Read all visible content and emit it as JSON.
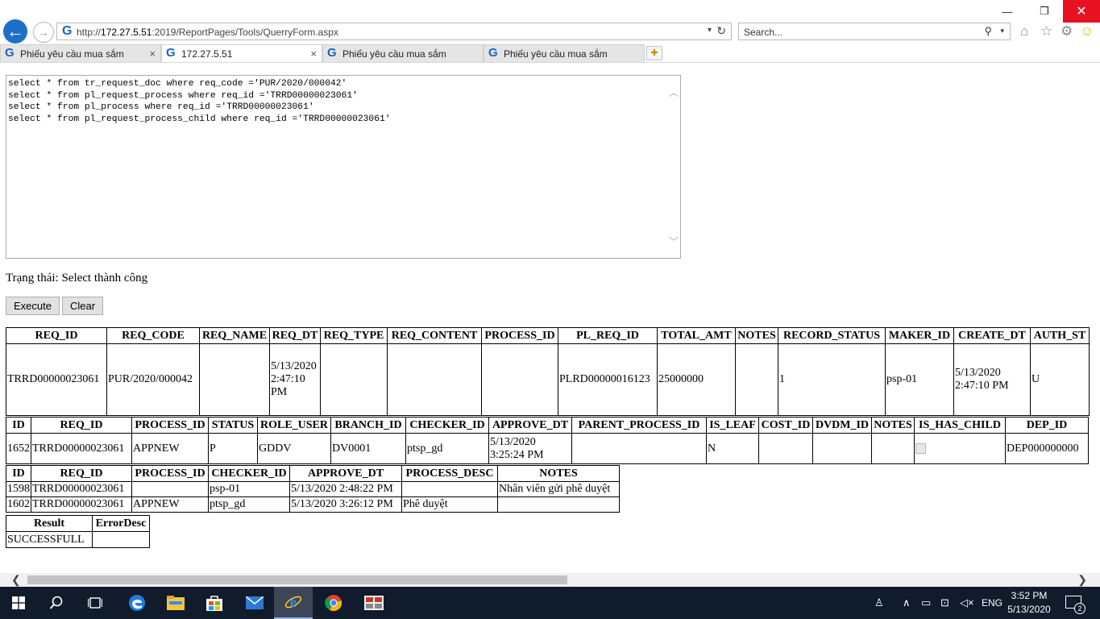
{
  "browser": {
    "address": {
      "prefix": "http://",
      "host": "172.27.5.51",
      "path": ":2019/ReportPages/Tools/QuerryForm.aspx"
    },
    "search_placeholder": "Search...",
    "tabs": [
      {
        "label": "Phiếu yêu cầu mua sắm",
        "active": false,
        "close": "×"
      },
      {
        "label": "172.27.5.51",
        "active": true,
        "close": "×"
      },
      {
        "label": "Phiếu yêu cầu mua sắm",
        "active": false,
        "close": ""
      },
      {
        "label": "Phiếu yêu cầu mua sắm",
        "active": false,
        "close": ""
      }
    ]
  },
  "page": {
    "query": "select * from tr_request_doc where req_code ='PUR/2020/000042'\nselect * from pl_request_process where req_id ='TRRD00000023061'\nselect * from pl_process where req_id ='TRRD00000023061'\nselect * from pl_request_process_child where req_id ='TRRD00000023061'",
    "status": "Trạng thái: Select thành công",
    "execute_label": "Execute",
    "clear_label": "Clear"
  },
  "results": [
    {
      "headers": [
        "REQ_ID",
        "REQ_CODE",
        "REQ_NAME",
        "REQ_DT",
        "REQ_TYPE",
        "REQ_CONTENT",
        "PROCESS_ID",
        "PL_REQ_ID",
        "TOTAL_AMT",
        "NOTES",
        "RECORD_STATUS",
        "MAKER_ID",
        "CREATE_DT",
        "AUTH_ST"
      ],
      "rows": [
        [
          "TRRD00000023061",
          "PUR/2020/000042",
          "",
          "5/13/2020 2:47:10 PM",
          "",
          "",
          "",
          "PLRD00000016123",
          "25000000",
          "",
          "1",
          "psp-01",
          "5/13/2020 2:47:10 PM",
          "U"
        ]
      ]
    },
    {
      "headers": [
        "ID",
        "REQ_ID",
        "PROCESS_ID",
        "STATUS",
        "ROLE_USER",
        "BRANCH_ID",
        "CHECKER_ID",
        "APPROVE_DT",
        "PARENT_PROCESS_ID",
        "IS_LEAF",
        "COST_ID",
        "DVDM_ID",
        "NOTES",
        "IS_HAS_CHILD",
        "DEP_ID"
      ],
      "rows": [
        [
          "1652",
          "TRRD00000023061",
          "APPNEW",
          "P",
          "GDDV",
          "DV0001",
          "ptsp_gd",
          "5/13/2020 3:25:24 PM",
          "",
          "N",
          "",
          "",
          "",
          "",
          "DEP000000000"
        ]
      ]
    },
    {
      "headers": [
        "ID",
        "REQ_ID",
        "PROCESS_ID",
        "CHECKER_ID",
        "APPROVE_DT",
        "PROCESS_DESC",
        "NOTES"
      ],
      "rows": [
        [
          "1598",
          "TRRD00000023061",
          "",
          "psp-01",
          "5/13/2020 2:48:22 PM",
          "",
          "Nhân viên gửi phê duyệt"
        ],
        [
          "1602",
          "TRRD00000023061",
          "APPNEW",
          "ptsp_gd",
          "5/13/2020 3:26:12 PM",
          "Phê duyệt",
          ""
        ]
      ]
    },
    {
      "headers": [
        "Result",
        "ErrorDesc"
      ],
      "rows": [
        [
          "SUCCESSFULL",
          ""
        ]
      ]
    }
  ],
  "taskbar": {
    "lang": "ENG",
    "time": "3:52 PM",
    "date": "5/13/2020",
    "notifications": "2"
  },
  "icons": [
    "back-arrow-icon",
    "forward-arrow-icon",
    "home-icon",
    "star-icon",
    "gear-icon",
    "smiley-icon",
    "search-icon",
    "refresh-icon",
    "windows-start-icon",
    "edge-icon",
    "file-explorer-icon",
    "store-icon",
    "mail-icon",
    "internet-explorer-icon",
    "chrome-icon"
  ],
  "colors": {
    "accent": "#1e6fc8",
    "close": "#e81123",
    "taskbar": "#101b2b"
  }
}
